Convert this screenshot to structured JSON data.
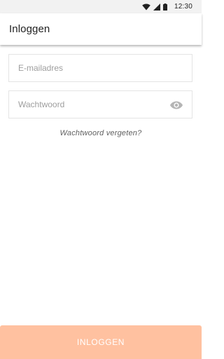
{
  "status_bar": {
    "time": "12:30",
    "icons": [
      "wifi-icon",
      "signal-icon",
      "battery-icon"
    ]
  },
  "app_bar": {
    "title": "Inloggen"
  },
  "form": {
    "email": {
      "placeholder": "E-mailadres",
      "value": ""
    },
    "password": {
      "placeholder": "Wachtwoord",
      "value": "",
      "toggle_icon": "eye-icon"
    },
    "forgot_password_label": "Wachtwoord vergeten?"
  },
  "actions": {
    "login_label": "INLOGGEN"
  },
  "colors": {
    "status_bar_bg": "#f2f2f2",
    "button_bg": "#ffc1a0",
    "button_text": "#ffffff",
    "field_border": "#e4e4e4",
    "placeholder": "#9e9e9e"
  }
}
